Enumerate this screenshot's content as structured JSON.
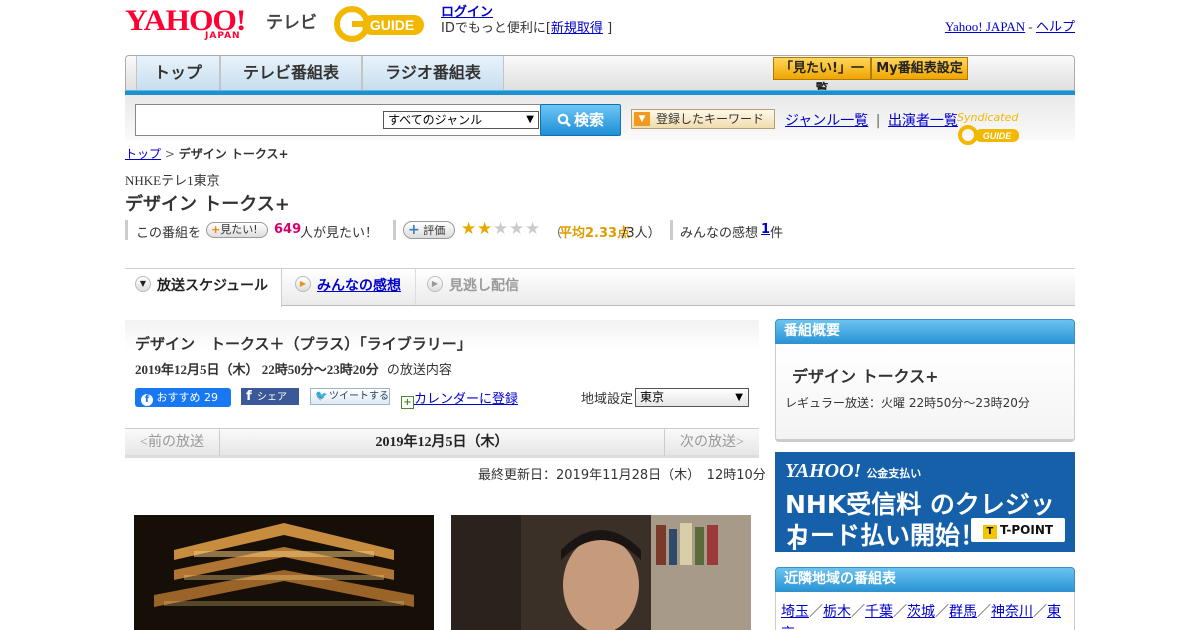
{
  "header": {
    "logo_yahoo": "YAHOO!",
    "logo_japan": "JAPAN",
    "logo_tv": "テレビ",
    "gguide_logo": "G-GUIDE",
    "login_link": "ログイン",
    "login_prompt": "IDでもっと便利に[",
    "signup_link": "新規取得",
    "login_close": "]",
    "yahoo_japan_link": "Yahoo! JAPAN",
    "separator": "-",
    "help_link": "ヘルプ"
  },
  "nav": {
    "tabs": [
      "トップ",
      "テレビ番組表",
      "ラジオ番組表"
    ],
    "mitai_list": "「見たい!」一覧",
    "my_schedule": "My番組表設定"
  },
  "search": {
    "placeholder": "",
    "genre_selected": "すべてのジャンル",
    "search_button": "検索",
    "keyword_button": "登録したキーワード",
    "genre_list_link": "ジャンル一覧",
    "divider": "|",
    "performer_list_link": "出演者一覧",
    "syndicated": "Syndicated"
  },
  "breadcrumb": {
    "top": "トップ",
    "sep": ">",
    "current": "デザイン トークス+"
  },
  "program": {
    "channel": "NHKEテレ1東京",
    "title": "デザイン トークス+",
    "want_prefix": "この番組を",
    "want_button": "見たい!",
    "want_count": "649",
    "want_suffix": "人が見たい！",
    "rate_button": "評価",
    "rating_stars": 2,
    "rating_max": 5,
    "rating_open": "（",
    "rating_avg": "平均2.33点",
    "rating_people": "/3人）",
    "impressions_label": "みんなの感想",
    "impressions_count": "1",
    "impressions_suffix": "件"
  },
  "tabs": {
    "schedule": "放送スケジュール",
    "impressions": "みんなの感想",
    "missed": "見逃し配信"
  },
  "episode": {
    "title": "デザイン　トークス＋（プラス）「ライブラリー」",
    "date_time": "2019年12月5日（木）  22時50分～23時20分",
    "date_suffix": "の放送内容",
    "fb_recommend": "おすすめ 29",
    "fb_share": "シェア",
    "tweet": "ツイートする",
    "calendar_link": "カレンダーに登録",
    "region_label": "地域設定",
    "region_selected": "東京"
  },
  "episode_nav": {
    "prev": "<前の放送",
    "current": "2019年12月5日（木）",
    "next": "次の放送>"
  },
  "updated": "最終更新日：2019年11月28日（木）　12時10分",
  "sidebar": {
    "overview_heading": "番組概要",
    "overview_title": "デザイン トークス+",
    "overview_regular": "レギュラー放送：火曜 22時50分～23時20分",
    "banner_line1": "YAHOO!",
    "banner_line1_sub": "公金支払い",
    "banner_line2": "NHK受信料 のクレジット",
    "banner_line3": "カード払い開始！",
    "banner_tpoint": "T-POINT",
    "nearby_heading": "近隣地域の番組表",
    "nearby_regions": [
      "埼玉",
      "栃木",
      "千葉",
      "茨城",
      "群馬",
      "神奈川",
      "東京"
    ],
    "nearby_sep": "／"
  }
}
